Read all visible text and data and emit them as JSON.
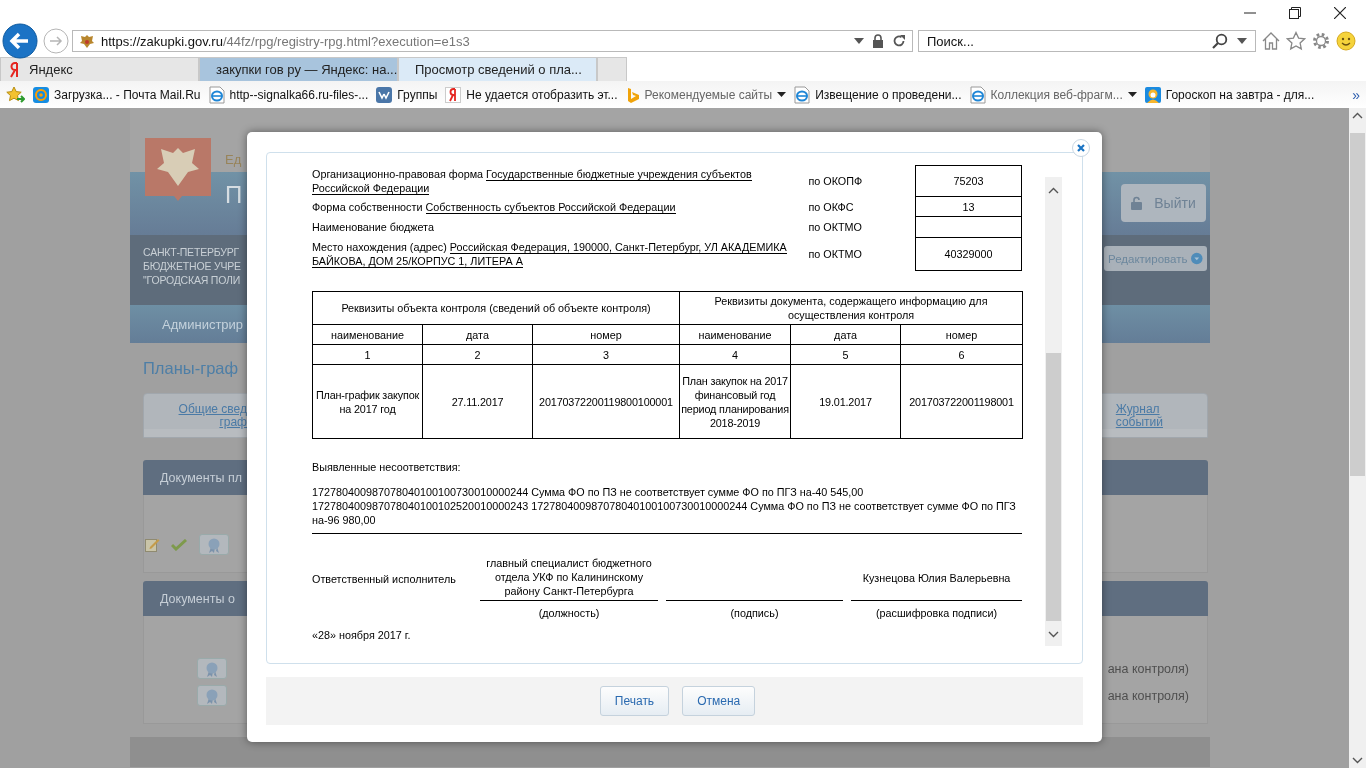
{
  "browser": {
    "address_bar": {
      "url_host": "https://zakupki.gov.ru",
      "url_path": "/44fz/rpg/registry-rpg.html?execution=e1s3"
    },
    "search": {
      "placeholder": "Поиск..."
    },
    "tabs": [
      {
        "label": "Яндекс",
        "kind": "yandex",
        "selected": false,
        "hover": false
      },
      {
        "label": "закупки гов ру — Яндекс: на...",
        "kind": "yandex",
        "selected": false,
        "hover": true
      },
      {
        "label": "Просмотр сведений о пла...",
        "kind": "emblem",
        "selected": true,
        "hover": false
      }
    ],
    "favorites": [
      {
        "label": "Загрузка... - Почта Mail.Ru",
        "kind": "mail",
        "menu": false,
        "dimmed": false
      },
      {
        "label": "http--signalka66.ru-files-...",
        "kind": "ie",
        "menu": false,
        "dimmed": false
      },
      {
        "label": "Группы",
        "kind": "vk",
        "menu": false,
        "dimmed": false
      },
      {
        "label": "Не удается отобразить эт...",
        "kind": "yandex",
        "menu": false,
        "dimmed": false
      },
      {
        "label": "Рекомендуемые сайты",
        "kind": "bing",
        "menu": true,
        "dimmed": true
      },
      {
        "label": "Извещение о проведени...",
        "kind": "ie",
        "menu": false,
        "dimmed": false
      },
      {
        "label": "Коллекция веб-фрагм...",
        "kind": "ie",
        "menu": true,
        "dimmed": true
      },
      {
        "label": "Гороскоп на завтра - для...",
        "kind": "person",
        "menu": false,
        "dimmed": false
      }
    ],
    "more": "»"
  },
  "page": {
    "header_small": "Ед",
    "header_title": "П",
    "logout_button": "Выйти",
    "org_name_lines": [
      "САНКТ-ПЕТЕРБУРГ",
      "БЮДЖЕТНОЕ УЧРЕ",
      "\"ГОРОДСКАЯ ПОЛИ"
    ],
    "edit_button": "Редактировать",
    "nav_item": "Администрир",
    "heading": "Планы-граф",
    "tabs": [
      {
        "label": "Общие свед\nграф"
      },
      {
        "label": "Журнал\nсобытий"
      }
    ],
    "panels": [
      {
        "title": "Документы пл"
      },
      {
        "title": "Документы о",
        "rows": [
          "ана контроля)",
          "ана контроля)"
        ]
      }
    ]
  },
  "dialog": {
    "org_rows": [
      {
        "label": "Организационно-правовая форма",
        "entry": "Государственные бюджетные учреждения субъектов Российской Федерации",
        "code": "по ОКОПФ",
        "code_value": "75203"
      },
      {
        "label": "Форма собственности",
        "entry": "Собственность субъектов Российской Федерации",
        "code": "по ОКФС",
        "code_value": "13"
      },
      {
        "label": "Наименование бюджета",
        "code": "по ОКТМО"
      },
      {
        "label": "Место нахождения (адрес)",
        "entry": "Российская Федерация, 190000, Санкт-Петербург, УЛ АКАДЕМИКА БАЙКОВА, ДОМ 25/КОРПУС 1, ЛИТЕРА А",
        "code": "по ОКТМО",
        "code_value": "40329000"
      }
    ],
    "table": {
      "group_headers": [
        "Реквизиты объекта контроля (сведений об объекте контроля)",
        "Реквизиты документа, содержащего информацию для осуществления контроля"
      ],
      "columns": [
        "наименование",
        "дата",
        "номер",
        "наименование",
        "дата",
        "номер"
      ],
      "column_numbers": [
        "1",
        "2",
        "3",
        "4",
        "5",
        "6"
      ],
      "rows": [
        [
          "План-график закупок на 2017 год",
          "27.11.2017",
          "20170372200119800100001",
          "План закупок на 2017 финансовый год период планирования 2018-2019",
          "19.01.2017",
          "201703722001198001"
        ]
      ]
    },
    "discrepancies_label": "Выявленные несоответствия:",
    "discrepancies": [
      "172780400987078040100100730010000244 Сумма ФО по ПЗ не соответствует сумме ФО по ПГЗ на-40 545,00",
      "172780400987078040100102520010000243 172780400987078040100100730010000244 Сумма ФО по ПЗ не соответствует сумме ФО по ПГЗ на-96 980,00"
    ],
    "signature": {
      "label": "Ответственный исполнитель",
      "position": "главный специалист бюджетного отдела УКФ по Калининскому району Санкт-Петербурга",
      "name": "Кузнецова Юлия Валерьевна",
      "captions": [
        "(должность)",
        "(подпись)",
        "(расшифровка подписи)"
      ]
    },
    "date": "«28» ноября 2017 г.",
    "buttons": [
      "Печать",
      "Отмена"
    ]
  }
}
